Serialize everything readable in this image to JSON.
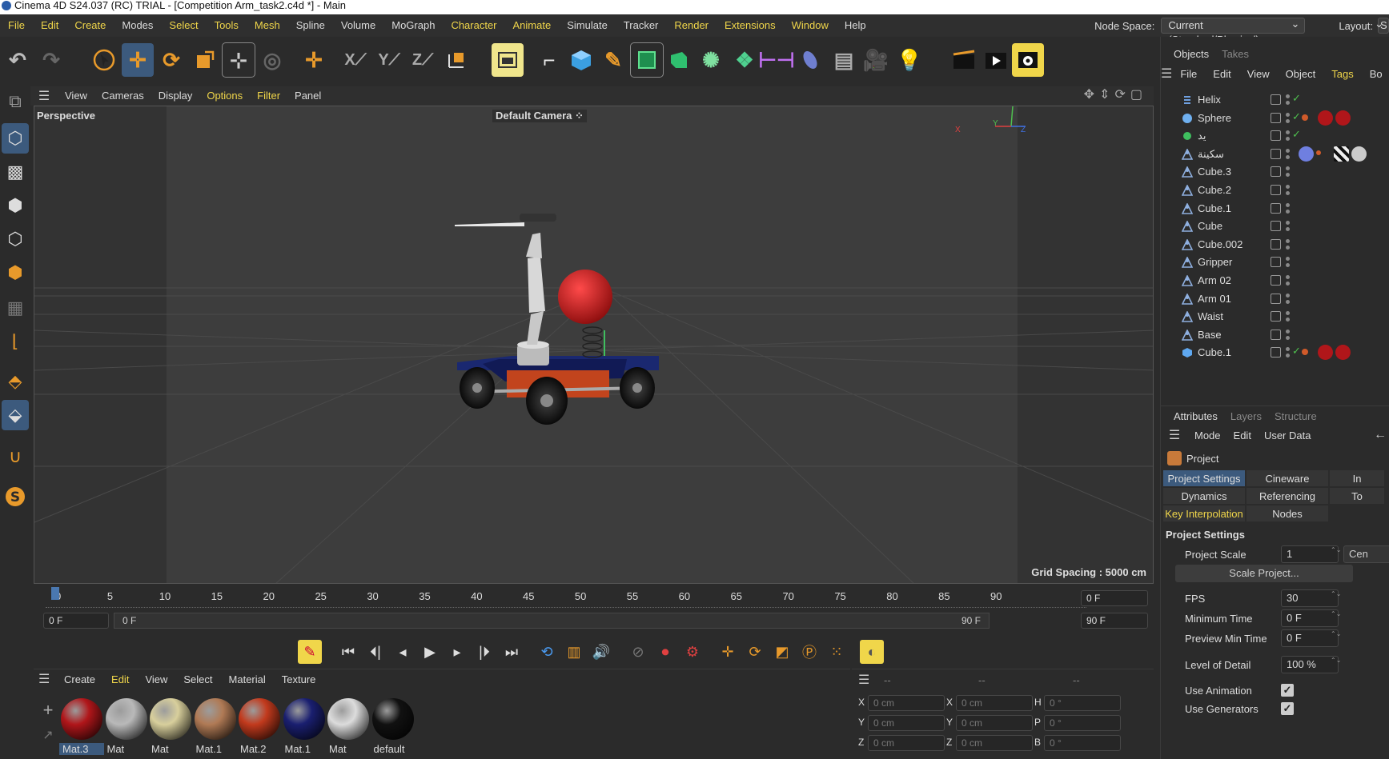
{
  "window": {
    "title": "Cinema 4D S24.037 (RC) TRIAL - [Competition Arm_task2.c4d *] - Main"
  },
  "menubar": {
    "items": [
      "File",
      "Edit",
      "Create",
      "Modes",
      "Select",
      "Tools",
      "Mesh",
      "Spline",
      "Volume",
      "MoGraph",
      "Character",
      "Animate",
      "Simulate",
      "Tracker",
      "Render",
      "Extensions",
      "Window",
      "Help"
    ],
    "highlighted": [
      "Edit",
      "Create",
      "Select",
      "Tools",
      "Mesh",
      "Character",
      "Animate",
      "Render",
      "Extensions",
      "Window",
      "File"
    ],
    "node_space_label": "Node Space:",
    "node_space_value": "Current (Standard/Physical)",
    "layout_label": "Layout:",
    "layout_value": "S"
  },
  "viewport": {
    "menu": [
      "View",
      "Cameras",
      "Display",
      "Options",
      "Filter",
      "Panel"
    ],
    "menu_highlighted": [
      "Options",
      "Filter"
    ],
    "view_name": "Perspective",
    "camera_name": "Default Camera",
    "grid_spacing": "Grid Spacing : 5000 cm",
    "axis_x": "X",
    "axis_y": "Y",
    "axis_z": "Z"
  },
  "timeline": {
    "ticks": [
      "0",
      "5",
      "10",
      "15",
      "20",
      "25",
      "30",
      "35",
      "40",
      "45",
      "50",
      "55",
      "60",
      "65",
      "70",
      "75",
      "80",
      "85",
      "90"
    ],
    "current_frame": "0 F",
    "start_field": "0 F",
    "range_start": "0 F",
    "range_end": "90 F",
    "end_field": "90 F"
  },
  "objects_panel": {
    "tabs": [
      "Objects",
      "Takes"
    ],
    "menu": [
      "File",
      "Edit",
      "View",
      "Object",
      "Tags",
      "Bo"
    ],
    "objects": [
      {
        "name": "Helix",
        "icon": "helix",
        "check": true
      },
      {
        "name": "Sphere",
        "icon": "sphere",
        "check": true
      },
      {
        "name": "يد",
        "icon": "null",
        "check": true
      },
      {
        "name": "سكينة",
        "icon": "joint",
        "check": false
      },
      {
        "name": "Cube.3",
        "icon": "joint",
        "check": false
      },
      {
        "name": "Cube.2",
        "icon": "joint",
        "check": false
      },
      {
        "name": "Cube.1",
        "icon": "joint",
        "check": false
      },
      {
        "name": "Cube",
        "icon": "joint",
        "check": false
      },
      {
        "name": "Cube.002",
        "icon": "joint",
        "check": false
      },
      {
        "name": "Gripper",
        "icon": "joint",
        "check": false
      },
      {
        "name": "Arm 02",
        "icon": "joint",
        "check": false
      },
      {
        "name": "Arm 01",
        "icon": "joint",
        "check": false
      },
      {
        "name": "Waist",
        "icon": "joint",
        "check": false
      },
      {
        "name": "Base",
        "icon": "joint",
        "check": false
      },
      {
        "name": "Cube.1",
        "icon": "cube",
        "check": true
      }
    ]
  },
  "attributes_panel": {
    "tabs": [
      "Attributes",
      "Layers",
      "Structure"
    ],
    "menu": [
      "Mode",
      "Edit",
      "User Data"
    ],
    "object_name": "Project",
    "buttons": [
      [
        "Project Settings",
        "Cineware",
        "In"
      ],
      [
        "Dynamics",
        "Referencing",
        "To"
      ],
      [
        "Key Interpolation",
        "Nodes"
      ]
    ],
    "section_title": "Project Settings",
    "project_scale_label": "Project Scale",
    "project_scale_value": "1",
    "project_scale_unit": "Cen",
    "scale_project_button": "Scale Project...",
    "fps_label": "FPS",
    "fps_value": "30",
    "min_time_label": "Minimum Time",
    "min_time_value": "0 F",
    "preview_min_label": "Preview Min Time",
    "preview_min_value": "0 F",
    "lod_label": "Level of Detail",
    "lod_value": "100 %",
    "use_animation_label": "Use Animation",
    "use_generators_label": "Use Generators"
  },
  "material_manager": {
    "menu": [
      "Create",
      "Edit",
      "View",
      "Select",
      "Material",
      "Texture"
    ],
    "menu_highlighted": [
      "Edit"
    ],
    "materials": [
      {
        "name": "Mat.3",
        "color": "#b0161a",
        "selected": true
      },
      {
        "name": "Mat",
        "color": "#b9b9b9",
        "selected": false
      },
      {
        "name": "Mat",
        "color": "#d8cf9c",
        "selected": false
      },
      {
        "name": "Mat.1",
        "color": "#b07a55",
        "selected": false
      },
      {
        "name": "Mat.2",
        "color": "#c23a1d",
        "selected": false
      },
      {
        "name": "Mat.1",
        "color": "#1a1f70",
        "selected": false
      },
      {
        "name": "Mat",
        "color": "#dcdcdc",
        "selected": false
      },
      {
        "name": "default",
        "color": "#111111",
        "selected": false
      }
    ]
  },
  "coordinates": {
    "headers": [
      "--",
      "--",
      "--"
    ],
    "rows": [
      {
        "a": "X",
        "av": "0 cm",
        "b": "X",
        "bv": "0 cm",
        "c": "H",
        "cv": "0 °"
      },
      {
        "a": "Y",
        "av": "0 cm",
        "b": "Y",
        "bv": "0 cm",
        "c": "P",
        "cv": "0 °"
      },
      {
        "a": "Z",
        "av": "0 cm",
        "b": "Z",
        "bv": "0 cm",
        "c": "B",
        "cv": "0 °"
      }
    ]
  },
  "colors": {
    "accent": "#3c5a7d",
    "highlight_text": "#f0d64a",
    "check": "#4fc04f"
  }
}
